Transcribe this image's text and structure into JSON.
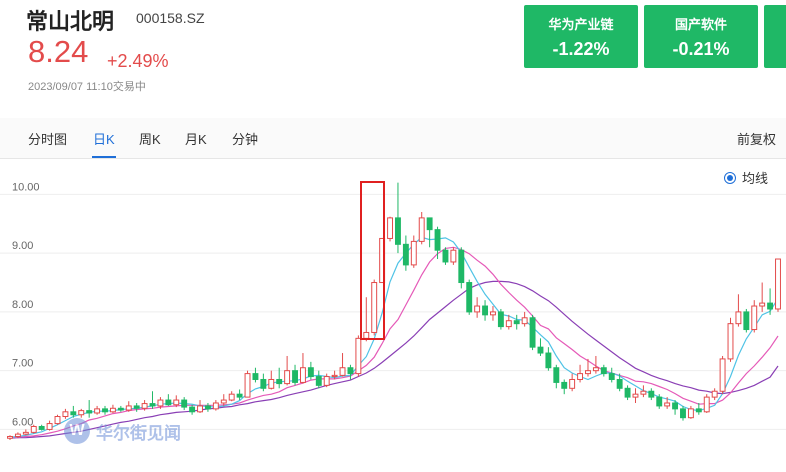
{
  "header": {
    "name": "常山北明",
    "code": "000158.SZ",
    "price": "8.24",
    "change": "+2.49%",
    "timestamp": "2023/09/07 11:10交易中"
  },
  "sectors": [
    {
      "name": "华为产业链",
      "change": "-1.22%"
    },
    {
      "name": "国产软件",
      "change": "-0.21%"
    }
  ],
  "tabs": [
    "分时图",
    "日K",
    "周K",
    "月K",
    "分钟"
  ],
  "active_tab": "日K",
  "adjust_label": "前复权",
  "ma_label": "均线",
  "watermark": "华尔街见闻",
  "colors": {
    "up": "#e34b4b",
    "down": "#1fb866",
    "accent": "#1f6fd8",
    "ma5": "#4fc3e6",
    "ma10": "#e55ab8",
    "ma20": "#8a3fb5"
  },
  "chart_data": {
    "type": "candlestick",
    "y_ticks": [
      "10.00",
      "9.00",
      "8.00",
      "7.00",
      "6.00"
    ],
    "ylim": [
      5.65,
      10.5
    ],
    "candles": [
      [
        5.85,
        5.88,
        5.82,
        5.9
      ],
      [
        5.88,
        5.92,
        5.85,
        5.95
      ],
      [
        5.92,
        5.95,
        5.9,
        6.0
      ],
      [
        5.95,
        6.05,
        5.93,
        6.08
      ],
      [
        6.05,
        6.0,
        5.98,
        6.08
      ],
      [
        6.0,
        6.1,
        5.98,
        6.15
      ],
      [
        6.1,
        6.22,
        6.08,
        6.25
      ],
      [
        6.22,
        6.3,
        6.18,
        6.35
      ],
      [
        6.3,
        6.25,
        6.2,
        6.4
      ],
      [
        6.25,
        6.32,
        6.2,
        6.35
      ],
      [
        6.32,
        6.28,
        6.2,
        6.5
      ],
      [
        6.28,
        6.35,
        6.25,
        6.4
      ],
      [
        6.35,
        6.3,
        6.25,
        6.4
      ],
      [
        6.3,
        6.36,
        6.28,
        6.42
      ],
      [
        6.36,
        6.33,
        6.3,
        6.4
      ],
      [
        6.33,
        6.4,
        6.3,
        6.48
      ],
      [
        6.4,
        6.36,
        6.3,
        6.45
      ],
      [
        6.36,
        6.44,
        6.32,
        6.5
      ],
      [
        6.44,
        6.4,
        6.35,
        6.65
      ],
      [
        6.4,
        6.5,
        6.35,
        6.55
      ],
      [
        6.5,
        6.42,
        6.4,
        6.6
      ],
      [
        6.42,
        6.5,
        6.38,
        6.58
      ],
      [
        6.5,
        6.38,
        6.33,
        6.55
      ],
      [
        6.38,
        6.3,
        6.25,
        6.42
      ],
      [
        6.3,
        6.4,
        6.28,
        6.5
      ],
      [
        6.4,
        6.35,
        6.3,
        6.45
      ],
      [
        6.35,
        6.45,
        6.32,
        6.5
      ],
      [
        6.45,
        6.5,
        6.4,
        6.6
      ],
      [
        6.5,
        6.6,
        6.48,
        6.65
      ],
      [
        6.6,
        6.55,
        6.5,
        6.68
      ],
      [
        6.55,
        6.95,
        6.55,
        7.0
      ],
      [
        6.95,
        6.85,
        6.8,
        7.05
      ],
      [
        6.85,
        6.7,
        6.65,
        6.95
      ],
      [
        6.7,
        6.85,
        6.68,
        7.0
      ],
      [
        6.85,
        6.78,
        6.7,
        7.05
      ],
      [
        6.78,
        7.0,
        6.75,
        7.25
      ],
      [
        7.0,
        6.8,
        6.75,
        7.1
      ],
      [
        6.8,
        7.05,
        6.78,
        7.3
      ],
      [
        7.05,
        6.9,
        6.85,
        7.15
      ],
      [
        6.9,
        6.75,
        6.7,
        7.0
      ],
      [
        6.75,
        6.9,
        6.72,
        6.95
      ],
      [
        6.9,
        6.92,
        6.85,
        7.0
      ],
      [
        6.92,
        7.05,
        6.9,
        7.3
      ],
      [
        7.05,
        6.95,
        6.85,
        7.1
      ],
      [
        6.95,
        7.55,
        6.9,
        7.6
      ],
      [
        7.55,
        7.65,
        7.5,
        8.25
      ],
      [
        7.65,
        8.5,
        7.6,
        8.55
      ],
      [
        8.5,
        9.25,
        8.5,
        9.25
      ],
      [
        9.25,
        9.6,
        9.2,
        9.62
      ],
      [
        9.6,
        9.15,
        9.0,
        10.2
      ],
      [
        9.15,
        8.8,
        8.7,
        9.3
      ],
      [
        8.8,
        9.2,
        8.75,
        9.3
      ],
      [
        9.2,
        9.6,
        9.15,
        9.7
      ],
      [
        9.6,
        9.4,
        9.1,
        9.55
      ],
      [
        9.4,
        9.05,
        8.9,
        9.45
      ],
      [
        9.05,
        8.85,
        8.8,
        9.1
      ],
      [
        8.85,
        9.05,
        8.8,
        9.1
      ],
      [
        9.05,
        8.5,
        8.4,
        9.1
      ],
      [
        8.5,
        8.0,
        7.95,
        8.55
      ],
      [
        8.0,
        8.1,
        7.9,
        8.25
      ],
      [
        8.1,
        7.95,
        7.85,
        8.2
      ],
      [
        7.95,
        8.0,
        7.85,
        8.1
      ],
      [
        8.0,
        7.75,
        7.7,
        8.05
      ],
      [
        7.75,
        7.85,
        7.7,
        7.95
      ],
      [
        7.85,
        7.8,
        7.7,
        7.95
      ],
      [
        7.8,
        7.9,
        7.75,
        8.0
      ],
      [
        7.9,
        7.4,
        7.35,
        7.95
      ],
      [
        7.4,
        7.3,
        7.25,
        7.55
      ],
      [
        7.3,
        7.05,
        7.0,
        7.4
      ],
      [
        7.05,
        6.8,
        6.7,
        7.1
      ],
      [
        6.8,
        6.7,
        6.6,
        6.85
      ],
      [
        6.7,
        6.85,
        6.65,
        6.95
      ],
      [
        6.85,
        6.95,
        6.8,
        7.1
      ],
      [
        6.95,
        7.0,
        6.9,
        7.2
      ],
      [
        7.0,
        7.05,
        6.95,
        7.25
      ],
      [
        7.05,
        6.95,
        6.9,
        7.1
      ],
      [
        6.95,
        6.85,
        6.8,
        7.05
      ],
      [
        6.85,
        6.7,
        6.65,
        6.95
      ],
      [
        6.7,
        6.55,
        6.5,
        6.75
      ],
      [
        6.55,
        6.6,
        6.45,
        6.7
      ],
      [
        6.6,
        6.65,
        6.55,
        6.75
      ],
      [
        6.65,
        6.55,
        6.5,
        6.7
      ],
      [
        6.55,
        6.4,
        6.35,
        6.6
      ],
      [
        6.4,
        6.45,
        6.35,
        6.55
      ],
      [
        6.45,
        6.35,
        6.25,
        6.5
      ],
      [
        6.35,
        6.2,
        6.15,
        6.4
      ],
      [
        6.2,
        6.35,
        6.18,
        6.4
      ],
      [
        6.35,
        6.3,
        6.25,
        6.45
      ],
      [
        6.3,
        6.55,
        6.28,
        6.6
      ],
      [
        6.55,
        6.65,
        6.5,
        6.7
      ],
      [
        6.65,
        7.2,
        6.6,
        7.25
      ],
      [
        7.2,
        7.8,
        7.15,
        7.9
      ],
      [
        7.8,
        8.0,
        7.75,
        8.3
      ],
      [
        8.0,
        7.7,
        7.65,
        8.05
      ],
      [
        7.7,
        8.1,
        7.65,
        8.2
      ],
      [
        8.1,
        8.15,
        8.0,
        8.5
      ],
      [
        8.15,
        8.05,
        7.95,
        8.4
      ],
      [
        8.05,
        8.9,
        8.0,
        8.9
      ]
    ],
    "ma5": [
      5.87,
      5.88,
      5.9,
      5.93,
      5.96,
      6.02,
      6.08,
      6.15,
      6.22,
      6.26,
      6.29,
      6.31,
      6.31,
      6.32,
      6.34,
      6.35,
      6.36,
      6.38,
      6.4,
      6.43,
      6.44,
      6.45,
      6.44,
      6.43,
      6.4,
      6.39,
      6.38,
      6.4,
      6.43,
      6.49,
      6.61,
      6.69,
      6.73,
      6.79,
      6.81,
      6.82,
      6.83,
      6.86,
      6.91,
      6.92,
      6.9,
      6.88,
      6.91,
      6.92,
      7.09,
      7.24,
      7.54,
      7.98,
      8.51,
      8.83,
      9.0,
      9.15,
      9.27,
      9.23,
      9.24,
      9.26,
      9.19,
      9.01,
      8.76,
      8.52,
      8.3,
      8.13,
      7.96,
      7.93,
      7.87,
      7.86,
      7.74,
      7.61,
      7.49,
      7.25,
      7.05,
      6.96,
      6.9,
      6.85,
      6.91,
      6.96,
      6.96,
      6.91,
      6.82,
      6.74,
      6.66,
      6.61,
      6.55,
      6.52,
      6.48,
      6.39,
      6.34,
      6.32,
      6.36,
      6.41,
      6.61,
      6.9,
      7.26,
      7.54,
      7.74,
      7.95,
      8.01,
      8.23
    ],
    "ma10": [
      5.86,
      5.87,
      5.88,
      5.89,
      5.91,
      5.94,
      5.97,
      6.01,
      6.06,
      6.1,
      6.16,
      6.19,
      6.23,
      6.27,
      6.29,
      6.32,
      6.34,
      6.35,
      6.36,
      6.38,
      6.39,
      6.4,
      6.41,
      6.41,
      6.41,
      6.41,
      6.41,
      6.42,
      6.43,
      6.45,
      6.5,
      6.54,
      6.58,
      6.6,
      6.64,
      6.71,
      6.75,
      6.79,
      6.84,
      6.86,
      6.86,
      6.86,
      6.88,
      6.91,
      7.0,
      7.09,
      7.23,
      7.46,
      7.71,
      7.87,
      8.12,
      8.37,
      8.63,
      8.85,
      8.99,
      9.08,
      9.1,
      9.06,
      8.99,
      8.88,
      8.78,
      8.64,
      8.47,
      8.33,
      8.2,
      8.08,
      7.93,
      7.77,
      7.71,
      7.56,
      7.46,
      7.36,
      7.25,
      7.17,
      7.08,
      7.0,
      6.96,
      6.92,
      6.88,
      6.82,
      6.81,
      6.78,
      6.73,
      6.68,
      6.61,
      6.53,
      6.48,
      6.43,
      6.44,
      6.44,
      6.5,
      6.62,
      6.79,
      6.95,
      7.08,
      7.23,
      7.39,
      7.59
    ],
    "ma20": [
      5.85,
      5.86,
      5.86,
      5.87,
      5.88,
      5.89,
      5.91,
      5.93,
      5.95,
      5.97,
      6.0,
      6.03,
      6.06,
      6.09,
      6.12,
      6.14,
      6.17,
      6.2,
      6.22,
      6.25,
      6.27,
      6.29,
      6.3,
      6.31,
      6.33,
      6.35,
      6.36,
      6.38,
      6.39,
      6.42,
      6.44,
      6.47,
      6.49,
      6.51,
      6.54,
      6.58,
      6.61,
      6.64,
      6.67,
      6.71,
      6.75,
      6.78,
      6.81,
      6.84,
      6.9,
      6.96,
      7.04,
      7.14,
      7.25,
      7.36,
      7.47,
      7.59,
      7.73,
      7.87,
      7.98,
      8.09,
      8.2,
      8.3,
      8.4,
      8.46,
      8.5,
      8.52,
      8.52,
      8.51,
      8.48,
      8.43,
      8.36,
      8.27,
      8.19,
      8.08,
      7.96,
      7.84,
      7.73,
      7.62,
      7.52,
      7.42,
      7.32,
      7.22,
      7.13,
      7.04,
      6.98,
      6.92,
      6.87,
      6.83,
      6.78,
      6.74,
      6.71,
      6.67,
      6.65,
      6.62,
      6.61,
      6.63,
      6.66,
      6.7,
      6.75,
      6.82,
      6.89,
      7.08
    ]
  }
}
